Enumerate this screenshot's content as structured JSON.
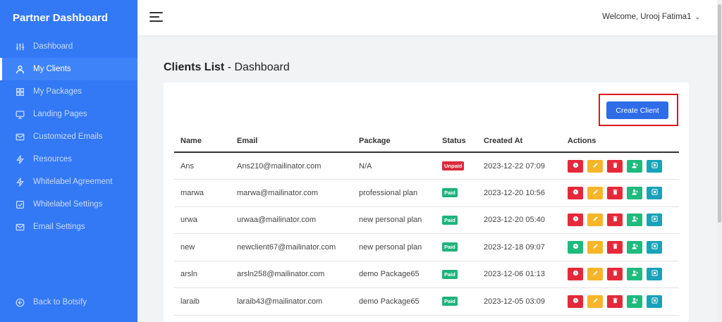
{
  "sidebar": {
    "brand": "Partner Dashboard",
    "items": [
      {
        "label": "Dashboard",
        "icon": "sliders-icon",
        "active": false
      },
      {
        "label": "My Clients",
        "icon": "user-icon",
        "active": true
      },
      {
        "label": "My Packages",
        "icon": "grid-icon",
        "active": false
      },
      {
        "label": "Landing Pages",
        "icon": "monitor-icon",
        "active": false
      },
      {
        "label": "Customized Emails",
        "icon": "mail-icon",
        "active": false
      },
      {
        "label": "Resources",
        "icon": "bolt-icon",
        "active": false
      },
      {
        "label": "Whitelabel Agreement",
        "icon": "bolt-icon",
        "active": false
      },
      {
        "label": "Whitelabel Settings",
        "icon": "checkbox-icon",
        "active": false
      },
      {
        "label": "Email Settings",
        "icon": "mail-icon",
        "active": false
      }
    ],
    "back_label": "Back to Botsify"
  },
  "topbar": {
    "welcome": "Welcome, Urooj Fatima1"
  },
  "page": {
    "title_bold": "Clients List",
    "title_rest": " - Dashboard",
    "create_label": "Create Client"
  },
  "table": {
    "headers": [
      "Name",
      "Email",
      "Package",
      "Status",
      "Created At",
      "Actions"
    ],
    "rows": [
      {
        "name": "Ans",
        "email": "Ans210@mailinator.com",
        "package": "N/A",
        "status": "Unpaid",
        "created": "2023-12-22 07:09"
      },
      {
        "name": "marwa",
        "email": "marwa@mailinator.com",
        "package": "professional plan",
        "status": "Paid",
        "created": "2023-12-20 10:56"
      },
      {
        "name": "urwa",
        "email": "urwaa@mailinator.com",
        "package": "new personal plan",
        "status": "Paid",
        "created": "2023-12-20 05:40"
      },
      {
        "name": "new",
        "email": "newclient67@mailinator.com",
        "package": "new personal plan",
        "status": "Paid",
        "created": "2023-12-18 09:07"
      },
      {
        "name": "arsln",
        "email": "arsln258@mailinator.com",
        "package": "demo Package65",
        "status": "Paid",
        "created": "2023-12-06 01:13"
      },
      {
        "name": "laraib",
        "email": "laraib43@mailinator.com",
        "package": "demo Package65",
        "status": "Paid",
        "created": "2023-12-05 03:09"
      }
    ],
    "row_first_action": [
      "red",
      "red",
      "red",
      "green",
      "red",
      "red"
    ]
  },
  "colors": {
    "sidebar": "#3378f5",
    "primary": "#2f6ce8",
    "paid": "#1cb37c",
    "unpaid": "#d92b3a",
    "highlight": "#e01818"
  }
}
